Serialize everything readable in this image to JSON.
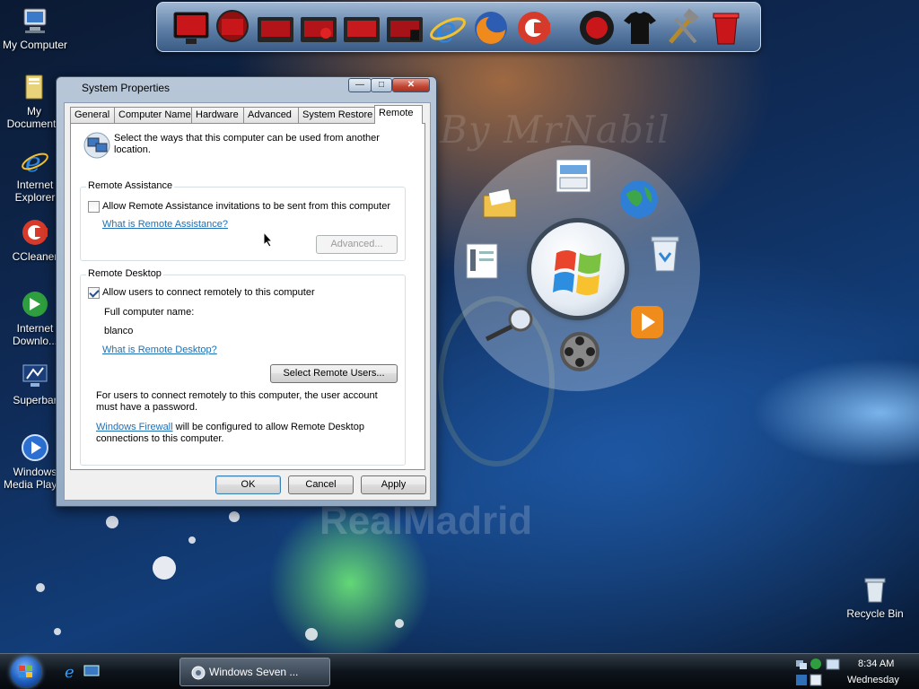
{
  "desktop": {
    "icons": [
      {
        "label": "My Computer"
      },
      {
        "label": "My Documents"
      },
      {
        "label": "Internet Explorer"
      },
      {
        "label": "CCleaner"
      },
      {
        "label": "Internet Downlo..."
      },
      {
        "label": "Superbar"
      },
      {
        "label": "Windows Media Player"
      },
      {
        "label": "Recycle Bin"
      }
    ],
    "watermark_signature": "By MrNabil",
    "watermark_team": "RealMadrid"
  },
  "dialog": {
    "title": "System Properties",
    "tabs": [
      "General",
      "Computer Name",
      "Hardware",
      "Advanced",
      "System Restore",
      "Remote"
    ],
    "active_tab": "Remote",
    "intro": "Select the ways that this computer can be used from another location.",
    "remote_assistance": {
      "title": "Remote Assistance",
      "checkbox_label": "Allow Remote Assistance invitations to be sent from this computer",
      "checked": false,
      "help_link": "What is Remote Assistance?",
      "advanced_button": "Advanced..."
    },
    "remote_desktop": {
      "title": "Remote Desktop",
      "checkbox_label": "Allow users to connect remotely to this computer",
      "checked": true,
      "full_name_label": "Full computer name:",
      "computer_name": "blanco",
      "help_link": "What is Remote Desktop?",
      "select_users_button": "Select Remote Users...",
      "password_note": "For users to connect remotely to this computer, the user account must have a password.",
      "firewall_link": "Windows Firewall",
      "firewall_note": " will be configured to allow Remote Desktop connections to this computer."
    },
    "buttons": {
      "ok": "OK",
      "cancel": "Cancel",
      "apply": "Apply"
    }
  },
  "taskbar": {
    "task_label": "Windows Seven ...",
    "time": "8:34 AM",
    "day": "Wednesday"
  },
  "colors": {
    "link": "#1e6fb5",
    "window_frame": "#93a9c3",
    "taskbar": "#0e141b"
  }
}
